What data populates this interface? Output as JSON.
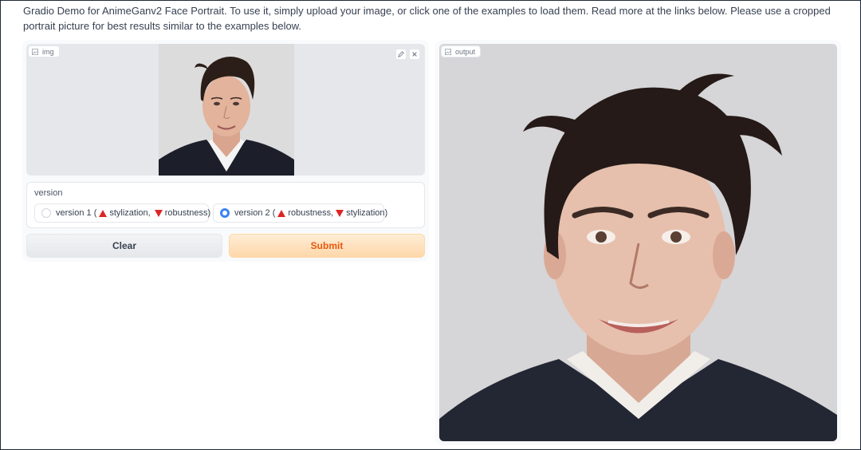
{
  "description": "Gradio Demo for AnimeGanv2 Face Portrait. To use it, simply upload your image, or click one of the examples to load them. Read more at the links below. Please use a cropped portrait picture for best results similar to the examples below.",
  "input_image": {
    "label": "img",
    "label_icon": "image-icon",
    "edit_icon": "pencil-icon",
    "clear_icon": "close-icon"
  },
  "version": {
    "title": "version",
    "options": [
      {
        "prefix": "version 1 (",
        "first": "stylization,",
        "second": "robustness)",
        "selected": false
      },
      {
        "prefix": "version 2 (",
        "first": "robustness,",
        "second": "stylization)",
        "selected": true
      }
    ]
  },
  "buttons": {
    "clear": "Clear",
    "submit": "Submit"
  },
  "output_image": {
    "label": "output",
    "label_icon": "image-icon"
  },
  "colors": {
    "accent_submit": "#ea580c",
    "radio_selected": "#3b82f6",
    "triangle": "#dc2626"
  }
}
